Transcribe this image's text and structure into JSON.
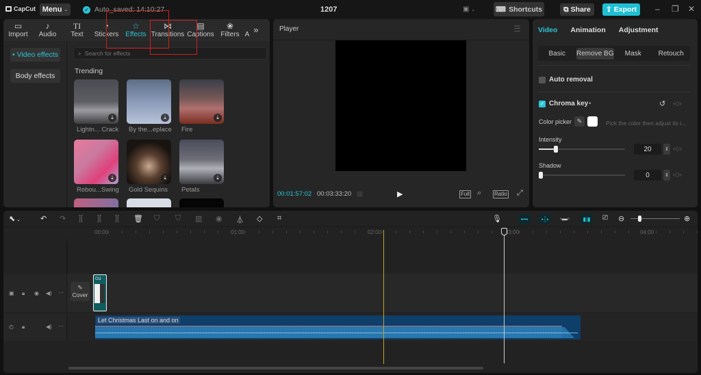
{
  "app": {
    "logo": "CapCut",
    "menu_label": "Menu",
    "autosave": "Auto_saved: 14:10:27",
    "project_title": "1207",
    "shortcuts_label": "Shortcuts",
    "share_label": "Share",
    "export_label": "Export",
    "accent_color": "#2bc4d6"
  },
  "media": {
    "tabs": [
      {
        "label": "Import",
        "icon": "import-icon"
      },
      {
        "label": "Audio",
        "icon": "audio-icon"
      },
      {
        "label": "Text",
        "icon": "text-icon"
      },
      {
        "label": "Stickers",
        "icon": "stickers-icon"
      },
      {
        "label": "Effects",
        "icon": "effects-icon",
        "active": true
      },
      {
        "label": "Transitions",
        "icon": "transitions-icon"
      },
      {
        "label": "Captions",
        "icon": "captions-icon"
      },
      {
        "label": "Filters",
        "icon": "filters-icon"
      },
      {
        "label": "A",
        "icon": "more-icon"
      }
    ],
    "side": [
      {
        "label": "• Video effects",
        "active": true
      },
      {
        "label": "Body effects"
      }
    ],
    "search_placeholder": "Search for effects",
    "section_title": "Trending",
    "effects": [
      {
        "label": "Lightn... Crack"
      },
      {
        "label": "By the...eplace"
      },
      {
        "label": "Fire"
      },
      {
        "label": "Rebou...Swing"
      },
      {
        "label": "Gold Sequins"
      },
      {
        "label": "Petals"
      }
    ]
  },
  "player": {
    "title": "Player",
    "current_time": "00:01:57:02",
    "total_time": "00:03:33:20",
    "full_label": "Full",
    "ratio_label": "Ratio"
  },
  "properties": {
    "tabs": [
      {
        "label": "Video",
        "active": true
      },
      {
        "label": "Animation"
      },
      {
        "label": "Adjustment"
      }
    ],
    "subtabs": [
      {
        "label": "Basic"
      },
      {
        "label": "Remove BG",
        "active": true
      },
      {
        "label": "Mask"
      },
      {
        "label": "Retouch"
      }
    ],
    "auto_removal_label": "Auto removal",
    "auto_removal_checked": false,
    "chroma_key_label": "Chroma key",
    "chroma_key_checked": true,
    "color_picker_label": "Color picker",
    "color_picker_hint": "Pick the color then adjust its i...",
    "picked_color": "#ffffff",
    "intensity_label": "Intensity",
    "intensity_value": "20",
    "intensity_percent": 20,
    "shadow_label": "Shadow",
    "shadow_value": "0",
    "shadow_percent": 0
  },
  "timeline": {
    "ruler_labels": [
      "00:00",
      "01:00",
      "02:00",
      "03:00",
      "04:00"
    ],
    "cover_label": "Cover",
    "video_clip_label": "cu",
    "audio_clip_label": "Let Christmas Last on and on",
    "zoom_percent": 15
  }
}
